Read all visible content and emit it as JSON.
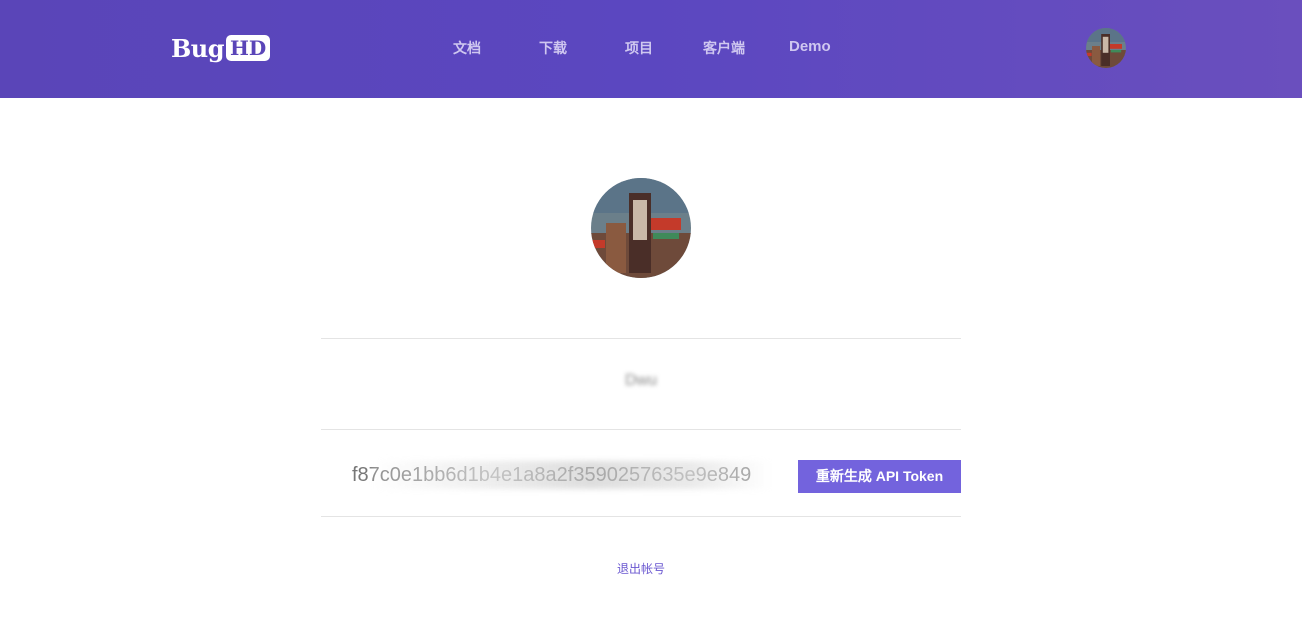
{
  "header": {
    "logo": {
      "text_bug": "Bug",
      "text_hd": "HD"
    },
    "nav": [
      {
        "label": "文档"
      },
      {
        "label": "下载"
      },
      {
        "label": "项目"
      },
      {
        "label": "客户端"
      },
      {
        "label": "Demo"
      }
    ]
  },
  "profile": {
    "username": "Dwu",
    "api_token": "f87c0e1bb6d1b4e1a8a2f3590257635e9e849",
    "regenerate_button": "重新生成 API Token",
    "logout_link": "退出帐号"
  },
  "colors": {
    "header_bg": "#5a45b8",
    "accent": "#7363dd",
    "link": "#6a57d0"
  }
}
